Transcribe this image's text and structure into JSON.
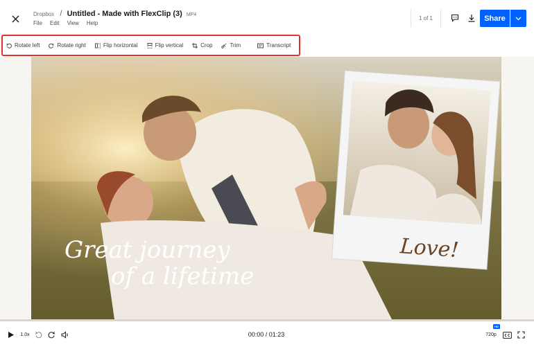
{
  "header": {
    "breadcrumb_root": "Dropbox",
    "separator": "/",
    "file_title": "Untitled - Made with FlexClip (3)",
    "file_ext": "MP4",
    "menu": [
      "File",
      "Edit",
      "View",
      "Help"
    ],
    "page_count": "1 of 1",
    "share_label": "Share"
  },
  "toolbar": {
    "items": [
      "Rotate left",
      "Rotate right",
      "Flip horizontal",
      "Flip vertical",
      "Crop",
      "Trim",
      "Transcript"
    ]
  },
  "video": {
    "overlay_text_line1": "Great journey",
    "overlay_text_line2": "of a lifetime",
    "polaroid_caption": "Love!"
  },
  "player": {
    "speed": "1.0x",
    "time": "00:00 / 01:23",
    "quality": "720p",
    "hd_badge": "HD",
    "progress_fraction": 0
  },
  "colors": {
    "accent": "#0061fe",
    "highlight_border": "#e0312f"
  },
  "icons": [
    "close-icon",
    "comment-icon",
    "download-icon",
    "chevron-down-icon",
    "rotate-left-icon",
    "rotate-right-icon",
    "flip-horizontal-icon",
    "flip-vertical-icon",
    "crop-icon",
    "trim-icon",
    "transcript-icon",
    "play-icon",
    "rewind-icon",
    "forward-icon",
    "volume-icon",
    "captions-icon",
    "fullscreen-icon"
  ]
}
